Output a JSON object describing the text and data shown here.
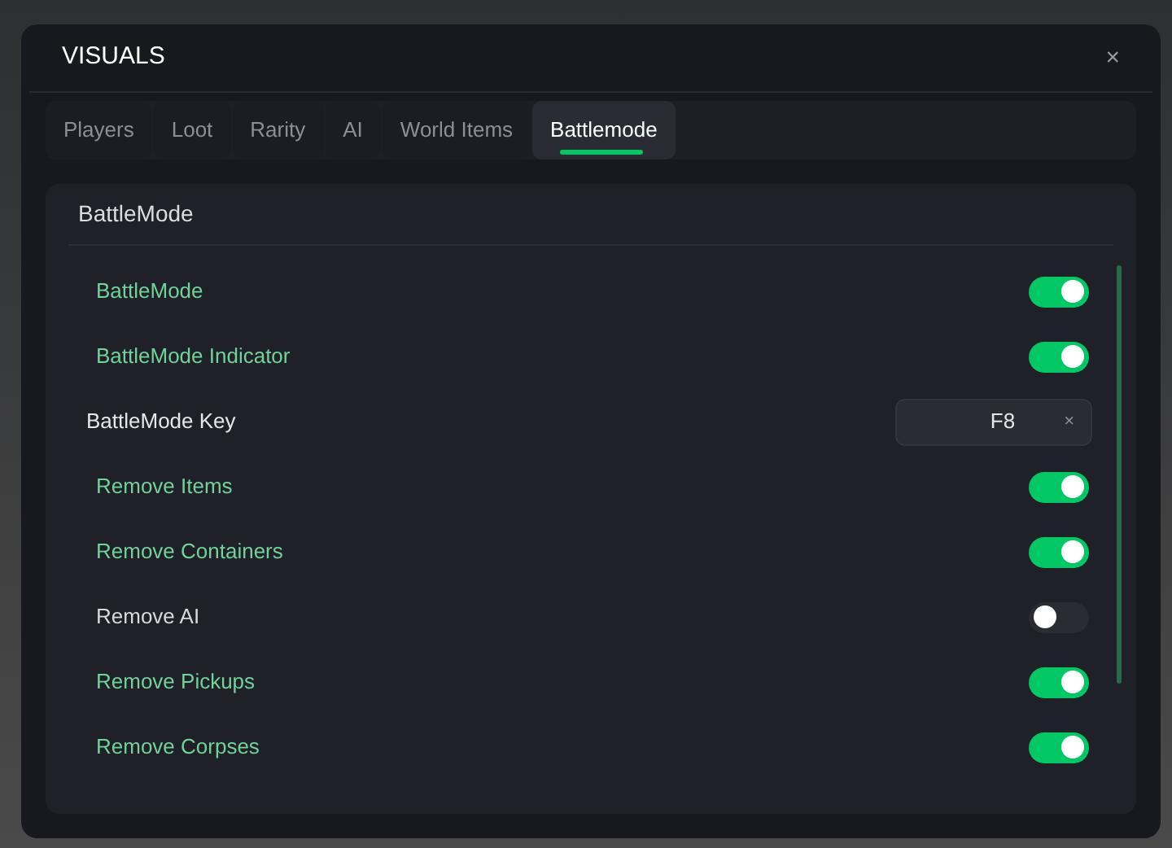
{
  "window": {
    "title": "VISUALS",
    "close": "×"
  },
  "tabs": [
    {
      "label": "Players",
      "selected": false
    },
    {
      "label": "Loot",
      "selected": false
    },
    {
      "label": "Rarity",
      "selected": false
    },
    {
      "label": "AI",
      "selected": false
    },
    {
      "label": "World Items",
      "selected": false
    },
    {
      "label": "Battlemode",
      "selected": true
    }
  ],
  "section": {
    "title": "BattleMode"
  },
  "rows": [
    {
      "kind": "toggle",
      "label": "BattleMode",
      "on": true
    },
    {
      "kind": "toggle",
      "label": "BattleMode Indicator",
      "on": true
    },
    {
      "kind": "key",
      "label": "BattleMode Key",
      "value": "F8",
      "clear": "×"
    },
    {
      "kind": "toggle",
      "label": "Remove Items",
      "on": true
    },
    {
      "kind": "toggle",
      "label": "Remove Containers",
      "on": true
    },
    {
      "kind": "toggle",
      "label": "Remove AI",
      "on": false
    },
    {
      "kind": "toggle",
      "label": "Remove Pickups",
      "on": true
    },
    {
      "kind": "toggle",
      "label": "Remove Corpses",
      "on": true
    }
  ]
}
